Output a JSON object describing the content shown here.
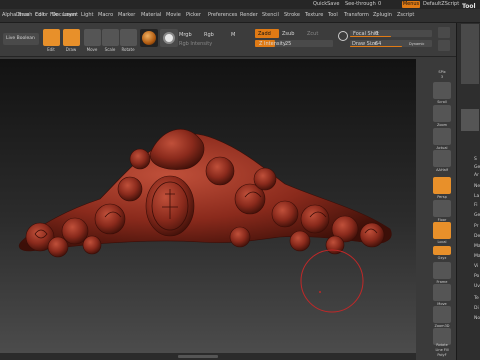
{
  "titlebar": {
    "quicksave": "QuickSave",
    "see_through": "See-through",
    "see_through_value": "0",
    "menus": "Menus",
    "default_script": "DefaultZScript"
  },
  "menubar": {
    "items": [
      "Alpha",
      "Brush",
      "Color",
      "Document",
      "Draw",
      "Edit",
      "File",
      "Layer",
      "Light",
      "Macro",
      "Marker",
      "Material",
      "Movie",
      "Picker",
      "Preferences",
      "Render",
      "Stencil",
      "Stroke",
      "Texture",
      "Tool",
      "Transform",
      "Zplugin",
      "Zscript"
    ]
  },
  "toolbar": {
    "live_boolean": "Live Boolean",
    "edit": "Edit",
    "draw": "Draw",
    "move": "Move",
    "scale": "Scale",
    "rotate": "Rotate",
    "mrgb": "Mrgb",
    "rgb": "Rgb",
    "m": "M",
    "rgb_intensity": "Rgb Intensity",
    "zadd": "Zadd",
    "zsub": "Zsub",
    "zcut": "Zcut",
    "z_intensity_label": "Z Intensity",
    "z_intensity_value": "25",
    "focal_shift_label": "Focal Shift",
    "focal_shift_value": "0",
    "draw_size_label": "Draw Size",
    "draw_size_value": "64",
    "dynamic": "Dynamic"
  },
  "slider_levels": {
    "z_intensity": 0.25,
    "focal_shift": 0.5,
    "draw_size": 0.64
  },
  "shelf": {
    "spix_label": "SPix",
    "spix_value": "3",
    "items": [
      "Scroll",
      "Zoom",
      "Actual",
      "AAHalf",
      "Persp",
      "Floor",
      "Local",
      "Gxyz",
      "Frame",
      "Move",
      "Zoom3D",
      "Rotate",
      "Line Fill",
      "PolyF"
    ]
  },
  "panel": {
    "title": "Tool",
    "items": [
      "S",
      "Ge",
      "Ar",
      "Ne",
      "La",
      "Fi",
      "Ge",
      "Pr",
      "De",
      "Ma",
      "Ma",
      "Vi",
      "Po",
      "Uv",
      "Te",
      "Di",
      "No"
    ]
  },
  "colors": {
    "accent": "#e07a14",
    "sculpt": "#8a2a1c",
    "cursor": "#c02828"
  }
}
